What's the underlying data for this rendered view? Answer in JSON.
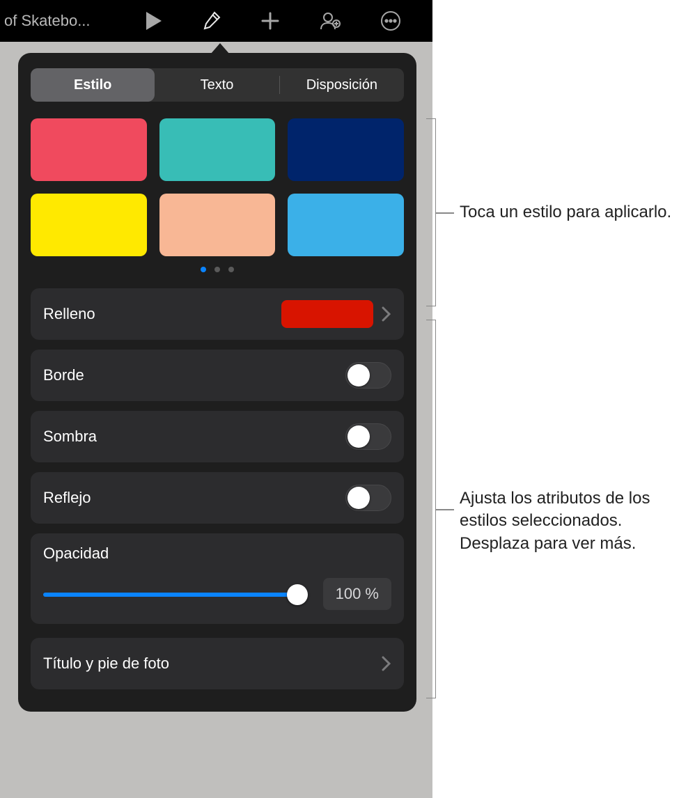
{
  "toolbar": {
    "doc_title": "of Skatebo..."
  },
  "popover": {
    "tabs": {
      "style": "Estilo",
      "text": "Texto",
      "layout": "Disposición"
    },
    "style_colors": [
      "#f04a5e",
      "#38bdb6",
      "#00246b",
      "#ffe900",
      "#f8b795",
      "#3bb0e8"
    ],
    "page_dots": {
      "count": 3,
      "active": 0
    },
    "fill": {
      "label": "Relleno",
      "color": "#d81400"
    },
    "border": {
      "label": "Borde"
    },
    "shadow": {
      "label": "Sombra"
    },
    "reflection": {
      "label": "Reflejo"
    },
    "opacity": {
      "label": "Opacidad",
      "value": "100 %"
    },
    "title_caption": {
      "label": "Título y pie de foto"
    }
  },
  "callouts": {
    "styles": "Toca un estilo para aplicarlo.",
    "attrs": "Ajusta los atributos de los estilos seleccionados. Desplaza para ver más."
  }
}
